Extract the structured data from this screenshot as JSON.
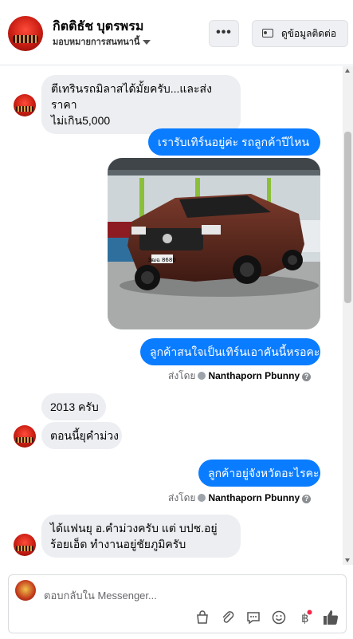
{
  "header": {
    "name": "กิตติธัช บุตรพรม",
    "subtitle": "มอบหมายการสนทนานี้",
    "more_label": "•••",
    "contact_button": "ดูข้อมูลติดต่อ"
  },
  "messages": [
    {
      "id": "m1",
      "direction": "incoming",
      "lines": [
        "ตีเทรินรถมิลาสได้มั้ยครับ...และส่งราคา",
        "ไม่เกิน5,000"
      ]
    },
    {
      "id": "m2",
      "direction": "outgoing",
      "lines": [
        "เรารับเทิร์นอยู่ค่ะ รถลูกค้าปีไหนคะ"
      ]
    },
    {
      "id": "m3",
      "direction": "outgoing",
      "type": "photo",
      "photo_plate": "3ฒฉ 8680"
    },
    {
      "id": "m4",
      "direction": "outgoing",
      "lines": [
        "ลูกค้าสนใจเป็นเทิร์นเอาคันนี้หรอคะ"
      ]
    },
    {
      "id": "m5",
      "direction": "incoming",
      "lines": [
        "2013 ครับ"
      ]
    },
    {
      "id": "m6",
      "direction": "incoming",
      "lines": [
        "ตอนนี้ยุคำม่วง"
      ]
    },
    {
      "id": "m7",
      "direction": "outgoing",
      "lines": [
        "ลูกค้าอยู่จังหวัดอะไรคะ"
      ]
    },
    {
      "id": "m8",
      "direction": "incoming",
      "lines": [
        "ได้แฟนยุ อ.คำม่วงครับ แต่ บปช.อยู่",
        "ร้อยเอ็ด ทำงานอยู่ชัยภูมิครับ"
      ]
    }
  ],
  "sent_by": {
    "prefix": "ส่งโดย",
    "name": "Nanthaporn Pbunny",
    "info": "?"
  },
  "composer": {
    "placeholder": "ตอบกลับใน Messenger...",
    "tools": [
      "bag-icon",
      "paperclip-icon",
      "quick-reply-icon",
      "emoji-icon",
      "baht-payment-icon",
      "like-icon"
    ],
    "badge_color": "#f02849"
  },
  "colors": {
    "outgoing": "#0a7cff",
    "incoming": "#eceef1"
  }
}
